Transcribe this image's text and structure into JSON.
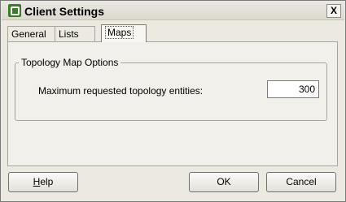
{
  "window": {
    "title": "Client Settings",
    "close_label": "X",
    "app_icon": "vsphere-client-icon"
  },
  "tabs": [
    {
      "label": "General",
      "active": false
    },
    {
      "label": "Lists",
      "active": false
    },
    {
      "label": "Maps",
      "active": true
    }
  ],
  "group": {
    "legend": "Topology Map Options",
    "field_label": "Maximum requested topology entities:",
    "field_value": "300"
  },
  "buttons": {
    "help_mnemonic": "H",
    "help_rest": "elp",
    "ok": "OK",
    "cancel": "Cancel"
  }
}
